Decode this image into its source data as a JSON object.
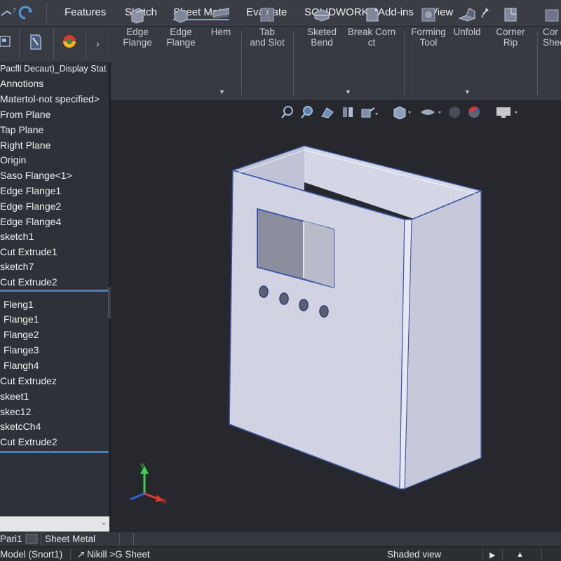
{
  "menubar": {
    "tabs": [
      "Features",
      "Sketch",
      "Sheet Metal",
      "Evaluate",
      "SOLIDWORKS Add-ins",
      "View"
    ],
    "active_tab": "Sheet Metal"
  },
  "ribbon": {
    "buttons": [
      {
        "line1": "Edge",
        "line2": "Flange",
        "icon": "edge-flange-icon"
      },
      {
        "line1": "Edge",
        "line2": "Flange",
        "icon": "edge-flange-icon"
      },
      {
        "line1": "Hem",
        "line2": "",
        "icon": "hem-icon"
      },
      {
        "line1": "Tab",
        "line2": "and Slot",
        "icon": "tab-slot-icon"
      },
      {
        "line1": "Sketed",
        "line2": "Bend",
        "icon": "sketched-bend-icon"
      },
      {
        "line1": "Break Corn",
        "line2": "ct",
        "icon": "break-corner-icon"
      },
      {
        "line1": "Forming",
        "line2": "Tool",
        "icon": "forming-tool-icon"
      },
      {
        "line1": "Unfold",
        "line2": "",
        "icon": "unfold-icon"
      },
      {
        "line1": "Corner",
        "line2": "Rip",
        "icon": "corner-rip-icon"
      },
      {
        "line1": "Cor",
        "line2": "Shee",
        "icon": "convert-sheet-icon"
      }
    ]
  },
  "tree": {
    "header": "Pacfll  Decaut)_Display Stat",
    "items_top": [
      "Annotions",
      "Matertol-not specified>",
      "From Plane",
      "Tap Plane",
      "Right Plane",
      "Origin",
      "Saso Flange<1>",
      "Edge Flange1",
      "Edge Flange2",
      "Edge Flange4",
      "sketch1",
      "Cut Extrude1",
      "sketch7",
      "Cut Extrude2"
    ],
    "items_bottom": [
      "Fleng1",
      "Flange1",
      "Flange2",
      "Flange3",
      "Flangh4",
      "Cut Extrudez",
      "skeet1",
      "skec12",
      "sketcCh4",
      "Cut Extrude2"
    ]
  },
  "bottom_tabs": {
    "part": "Pari1",
    "sheet": "Sheet Metal"
  },
  "status": {
    "model": "Model (Snort1)",
    "middle": "Nikill >G Sheet",
    "view": "Shaded view"
  },
  "triad": {
    "x": "X",
    "y": "Y"
  },
  "colors": {
    "accent": "#6fa6e6",
    "divider": "#4d7fb5",
    "part_face": "#d2d4e2",
    "part_edge": "#3d5aa8"
  }
}
